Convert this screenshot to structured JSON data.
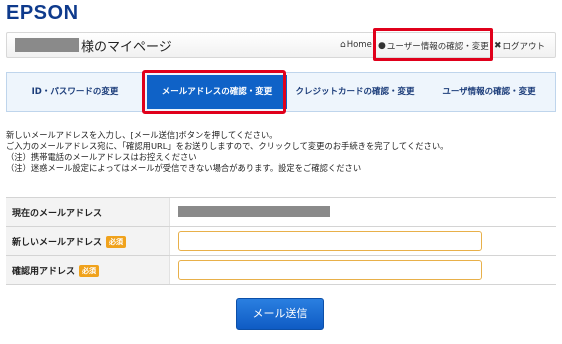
{
  "brand": {
    "logo_text": "EPSON",
    "color": "#0e3a8c"
  },
  "header": {
    "title_suffix": "様のマイページ",
    "links": {
      "home": "Home",
      "user_info": "ユーザー情報の確認・変更",
      "logout": "ログアウト"
    },
    "icons": {
      "home": "home-icon",
      "user": "user-icon",
      "logout": "close-icon"
    },
    "highlight_color": "#e0001b"
  },
  "tabs": [
    {
      "label": "ID・パスワードの変更",
      "active": false
    },
    {
      "label": "メールアドレスの確認・変更",
      "active": true
    },
    {
      "label": "クレジットカードの確認・変更",
      "active": false
    },
    {
      "label": "ユーザ情報の確認・変更",
      "active": false
    }
  ],
  "instructions": [
    "新しいメールアドレスを入力し、[メール送信]ボタンを押してください。",
    "ご入力のメールアドレス宛に、「確認用URL」をお送りしますので、クリックして変更のお手続きを完了してください。",
    "（注）携帯電話のメールアドレスはお控えください",
    "（注）迷惑メール設定によってはメールが受信できない場合があります。設定をご確認ください"
  ],
  "form": {
    "current_email_label": "現在のメールアドレス",
    "new_email_label": "新しいメールアドレス",
    "confirm_email_label": "確認用アドレス",
    "required_badge": "必須",
    "new_email_value": "",
    "confirm_email_value": ""
  },
  "send_button": {
    "label": "メール送信",
    "color": "#0f5bc4"
  }
}
